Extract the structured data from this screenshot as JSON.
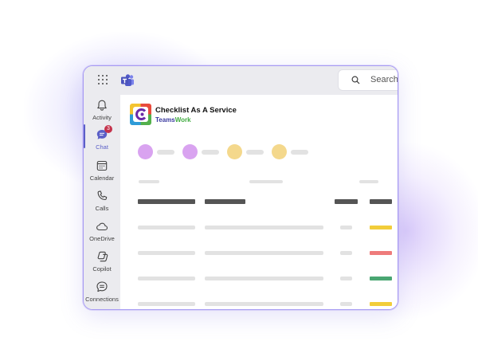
{
  "search": {
    "placeholder": "Search ("
  },
  "rail": {
    "items": [
      {
        "label": "Activity",
        "icon": "bell-icon"
      },
      {
        "label": "Chat",
        "icon": "chat-icon",
        "badge": "3"
      },
      {
        "label": "Calendar",
        "icon": "calendar-icon"
      },
      {
        "label": "Calls",
        "icon": "phone-icon"
      },
      {
        "label": "OneDrive",
        "icon": "cloud-icon"
      },
      {
        "label": "Copilot",
        "icon": "copilot-icon"
      },
      {
        "label": "Connections",
        "icon": "connections-icon"
      }
    ]
  },
  "app": {
    "title": "Checklist As A Service",
    "brand_part1": "Teams",
    "brand_part2": "Work"
  },
  "colors": {
    "accent": "#5b5fc7",
    "chip_purple": "#d9a3f0",
    "chip_yellow": "#f4d88c",
    "status_yellow": "#f2cd3a",
    "status_red": "#ee7b7b",
    "status_green": "#4aa672"
  },
  "filter_chips": [
    {
      "color": "#d9a3f0"
    },
    {
      "color": "#d9a3f0"
    },
    {
      "color": "#f4d88c"
    },
    {
      "color": "#f4d88c"
    }
  ],
  "table_rows": [
    {
      "status_color": "#f2cd3a"
    },
    {
      "status_color": "#ee7b7b"
    },
    {
      "status_color": "#4aa672"
    },
    {
      "status_color": "#f2cd3a"
    }
  ]
}
